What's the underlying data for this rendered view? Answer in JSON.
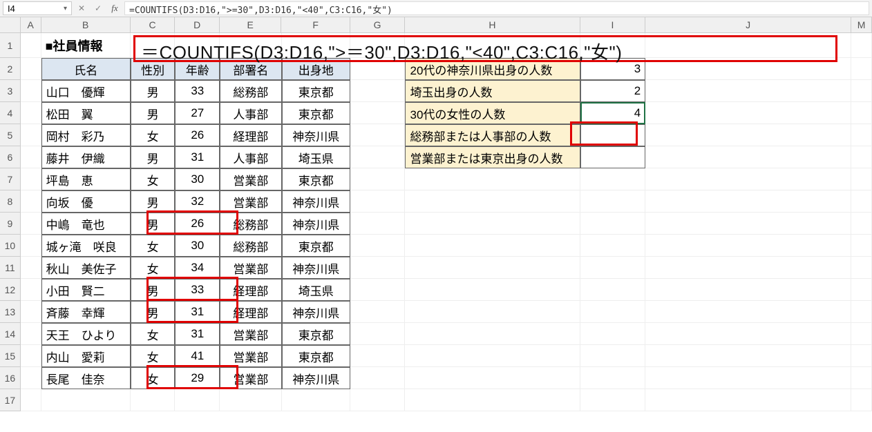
{
  "formulaBar": {
    "cellRef": "I4",
    "formula": "=COUNTIFS(D3:D16,\">=30\",D3:D16,\"<40\",C3:C16,\"女\")"
  },
  "overlayFormula": "＝COUNTIFS(D3:D16,\">＝30\",D3:D16,\"<40\",C3:C16,\"女\")",
  "columns": [
    "A",
    "B",
    "C",
    "D",
    "E",
    "F",
    "G",
    "H",
    "I",
    "J",
    "M"
  ],
  "title": "■社員情報",
  "headers": {
    "name": "氏名",
    "gender": "性別",
    "age": "年齢",
    "dept": "部署名",
    "origin": "出身地"
  },
  "employees": [
    {
      "name": "山口　優輝",
      "gender": "男",
      "age": "33",
      "dept": "総務部",
      "origin": "東京都"
    },
    {
      "name": "松田　翼",
      "gender": "男",
      "age": "27",
      "dept": "人事部",
      "origin": "東京都"
    },
    {
      "name": "岡村　彩乃",
      "gender": "女",
      "age": "26",
      "dept": "経理部",
      "origin": "神奈川県"
    },
    {
      "name": "藤井　伊織",
      "gender": "男",
      "age": "31",
      "dept": "人事部",
      "origin": "埼玉県"
    },
    {
      "name": "坪島　恵",
      "gender": "女",
      "age": "30",
      "dept": "営業部",
      "origin": "東京都"
    },
    {
      "name": "向坂　優",
      "gender": "男",
      "age": "32",
      "dept": "営業部",
      "origin": "神奈川県"
    },
    {
      "name": "中嶋　竜也",
      "gender": "男",
      "age": "26",
      "dept": "総務部",
      "origin": "神奈川県"
    },
    {
      "name": "城ヶ滝　咲良",
      "gender": "女",
      "age": "30",
      "dept": "総務部",
      "origin": "東京都"
    },
    {
      "name": "秋山　美佐子",
      "gender": "女",
      "age": "34",
      "dept": "営業部",
      "origin": "神奈川県"
    },
    {
      "name": "小田　賢二",
      "gender": "男",
      "age": "33",
      "dept": "経理部",
      "origin": "埼玉県"
    },
    {
      "name": "斉藤　幸輝",
      "gender": "男",
      "age": "31",
      "dept": "経理部",
      "origin": "神奈川県"
    },
    {
      "name": "天王　ひより",
      "gender": "女",
      "age": "31",
      "dept": "営業部",
      "origin": "東京都"
    },
    {
      "name": "内山　愛莉",
      "gender": "女",
      "age": "41",
      "dept": "営業部",
      "origin": "東京都"
    },
    {
      "name": "長尾　佳奈",
      "gender": "女",
      "age": "29",
      "dept": "営業部",
      "origin": "神奈川県"
    }
  ],
  "summary": [
    {
      "label": "20代の神奈川県出身の人数",
      "value": "3"
    },
    {
      "label": "埼玉出身の人数",
      "value": "2"
    },
    {
      "label": "30代の女性の人数",
      "value": "4"
    },
    {
      "label": "総務部または人事部の人数",
      "value": ""
    },
    {
      "label": "営業部または東京出身の人数",
      "value": ""
    }
  ],
  "rowNums": [
    "1",
    "2",
    "3",
    "4",
    "5",
    "6",
    "7",
    "8",
    "9",
    "10",
    "11",
    "12",
    "13",
    "14",
    "15",
    "16",
    "17"
  ]
}
